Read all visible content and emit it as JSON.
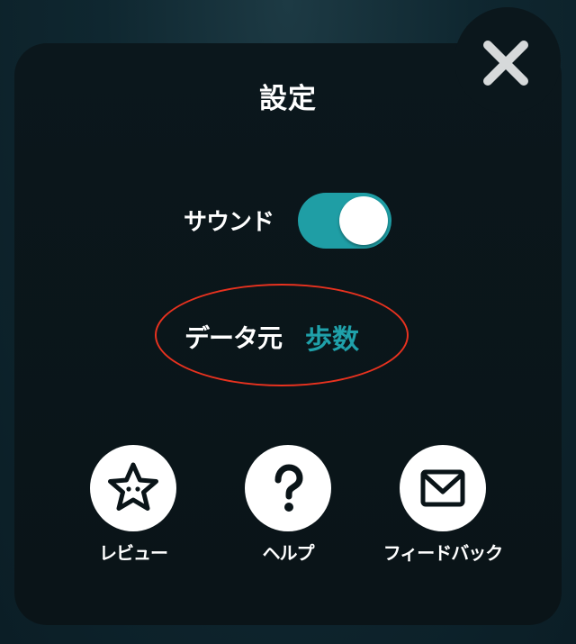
{
  "dialog": {
    "title": "設定",
    "close_icon": "close-icon"
  },
  "settings": {
    "sound_label": "サウンド",
    "sound_enabled": true,
    "data_source_label": "データ元",
    "data_source_value": "歩数"
  },
  "actions": [
    {
      "label": "レビュー",
      "icon": "star-face-icon"
    },
    {
      "label": "ヘルプ",
      "icon": "question-mark-icon"
    },
    {
      "label": "フィードバック",
      "icon": "mail-icon"
    }
  ],
  "colors": {
    "accent": "#1f9ea5",
    "highlight_annotation": "#e8321f",
    "panel_background": "#0b171c"
  }
}
